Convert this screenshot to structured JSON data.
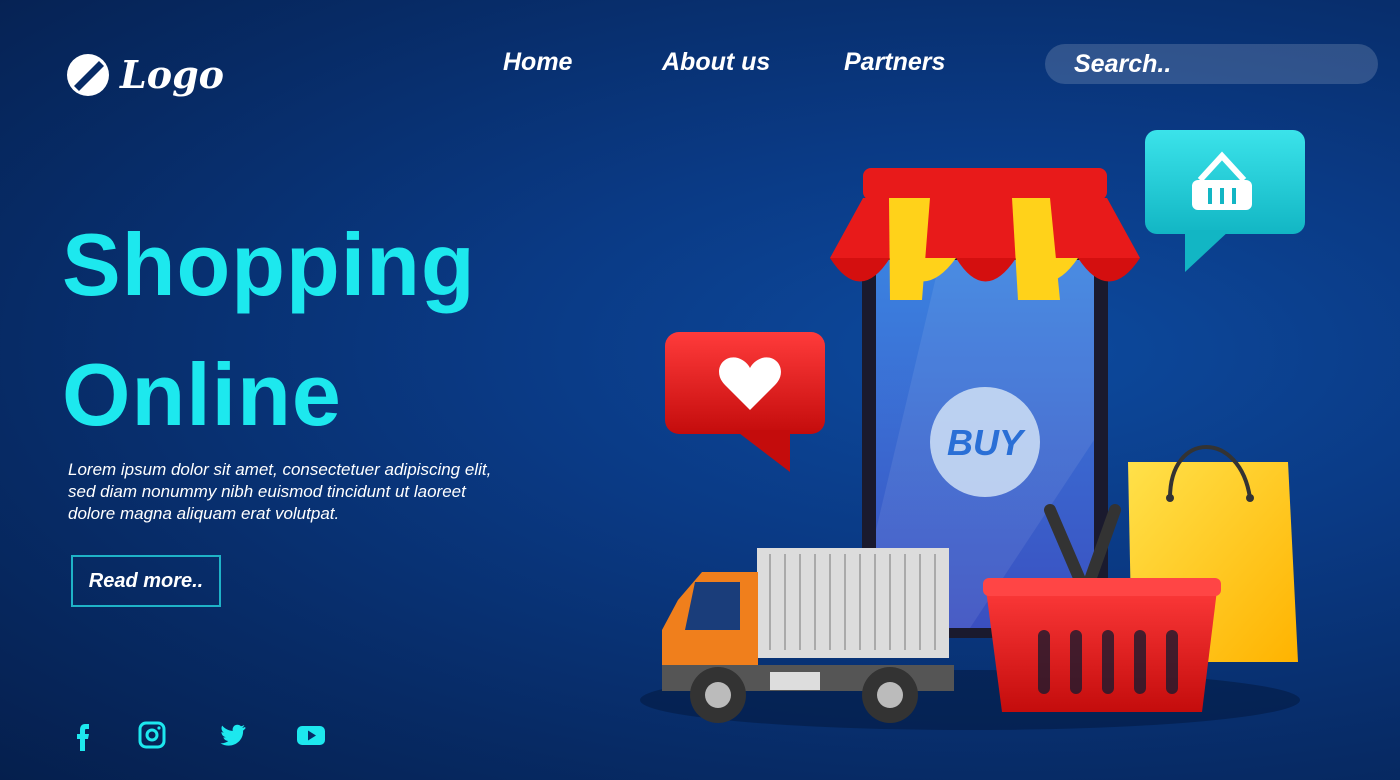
{
  "logo": {
    "text": "Logo",
    "icon": "logo-icon"
  },
  "nav": {
    "items": [
      "Home",
      "About us",
      "Partners"
    ]
  },
  "search": {
    "placeholder": "Search.."
  },
  "hero": {
    "title_line1": "Shopping",
    "title_line2": "Online",
    "body_line1": "Lorem ipsum dolor sit amet, consectetuer adipiscing elit,",
    "body_line2": "sed diam nonummy nibh euismod tincidunt ut laoreet",
    "body_line3": "dolore magna aliquam erat volutpat.",
    "cta_label": "Read more.."
  },
  "illustration": {
    "buy_label": "BUY",
    "icons": [
      "storefront-icon",
      "smartphone-icon",
      "heart-icon",
      "basket-icon",
      "delivery-truck-icon",
      "shopping-bag-icon"
    ]
  },
  "social": {
    "icons": [
      "facebook-icon",
      "instagram-icon",
      "twitter-icon",
      "youtube-icon"
    ]
  },
  "colors": {
    "accent": "#1de8ee",
    "background": "#072b66",
    "outline": "#1fb3c7"
  }
}
